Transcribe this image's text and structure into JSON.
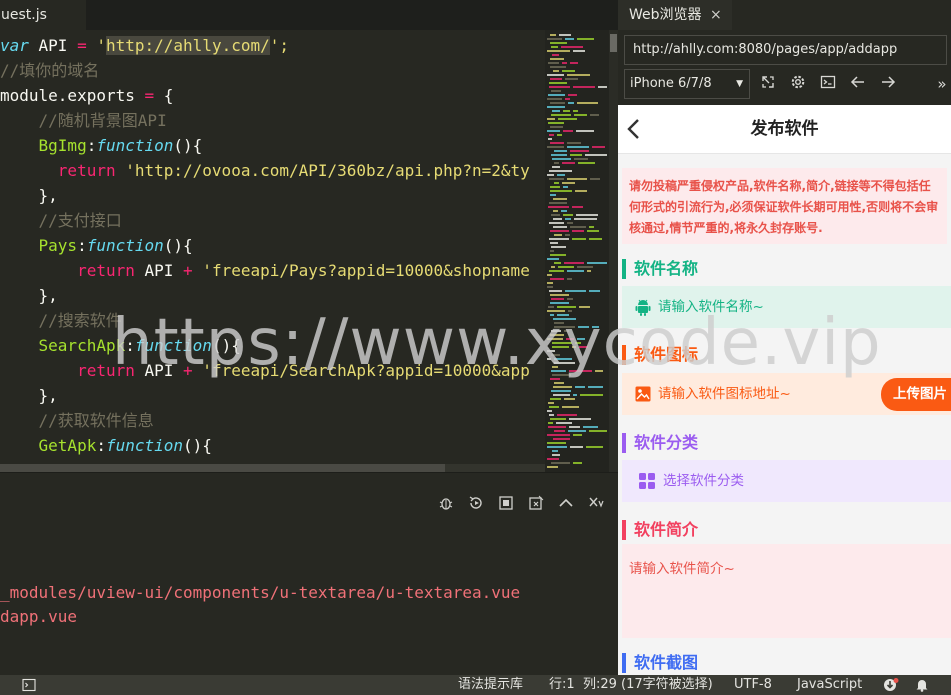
{
  "editor": {
    "tab_label": "uest.js",
    "lines": [
      {
        "segments": [
          {
            "t": "var",
            "c": "kw-i"
          },
          {
            "t": " API ",
            "c": ""
          },
          {
            "t": "=",
            "c": "op"
          },
          {
            "t": " '",
            "c": "str"
          },
          {
            "t": "http://ahlly.com/",
            "c": "str sel"
          },
          {
            "t": "';",
            "c": "str"
          }
        ]
      },
      {
        "segments": [
          {
            "t": "//填你的域名",
            "c": "cm"
          }
        ]
      },
      {
        "segments": [
          {
            "t": "module.exports ",
            "c": ""
          },
          {
            "t": "=",
            "c": "op"
          },
          {
            "t": " {",
            "c": ""
          }
        ]
      },
      {
        "segments": [
          {
            "t": "    //随机背景图API",
            "c": "cm"
          }
        ]
      },
      {
        "segments": [
          {
            "t": "    ",
            "c": ""
          },
          {
            "t": "BgImg",
            "c": "fn"
          },
          {
            "t": ":",
            "c": ""
          },
          {
            "t": "function",
            "c": "kw-i"
          },
          {
            "t": "(){",
            "c": ""
          }
        ]
      },
      {
        "segments": [
          {
            "t": "      ",
            "c": ""
          },
          {
            "t": "return",
            "c": "op"
          },
          {
            "t": " 'http://ovooa.com/API/360bz/api.php?n=2&ty",
            "c": "str"
          }
        ]
      },
      {
        "segments": [
          {
            "t": "    },",
            "c": ""
          }
        ]
      },
      {
        "segments": [
          {
            "t": "    //支付接口",
            "c": "cm"
          }
        ]
      },
      {
        "segments": [
          {
            "t": "    ",
            "c": ""
          },
          {
            "t": "Pays",
            "c": "fn"
          },
          {
            "t": ":",
            "c": ""
          },
          {
            "t": "function",
            "c": "kw-i"
          },
          {
            "t": "(){",
            "c": ""
          }
        ]
      },
      {
        "segments": [
          {
            "t": "        ",
            "c": ""
          },
          {
            "t": "return",
            "c": "op"
          },
          {
            "t": " API ",
            "c": ""
          },
          {
            "t": "+",
            "c": "op"
          },
          {
            "t": " 'freeapi/Pays?appid=10000&shopname",
            "c": "str"
          }
        ]
      },
      {
        "segments": [
          {
            "t": "    },",
            "c": ""
          }
        ]
      },
      {
        "segments": [
          {
            "t": "    //搜索软件",
            "c": "cm"
          }
        ]
      },
      {
        "segments": [
          {
            "t": "    ",
            "c": ""
          },
          {
            "t": "SearchApk",
            "c": "fn"
          },
          {
            "t": ":",
            "c": ""
          },
          {
            "t": "function",
            "c": "kw-i"
          },
          {
            "t": "(){",
            "c": ""
          }
        ]
      },
      {
        "segments": [
          {
            "t": "        ",
            "c": ""
          },
          {
            "t": "return",
            "c": "op"
          },
          {
            "t": " API ",
            "c": ""
          },
          {
            "t": "+",
            "c": "op"
          },
          {
            "t": " 'freeapi/SearchApk?appid=10000&app",
            "c": "str"
          }
        ]
      },
      {
        "segments": [
          {
            "t": "    },",
            "c": ""
          }
        ]
      },
      {
        "segments": [
          {
            "t": "    //获取软件信息",
            "c": "cm"
          }
        ]
      },
      {
        "segments": [
          {
            "t": "    ",
            "c": ""
          },
          {
            "t": "GetApk",
            "c": "fn"
          },
          {
            "t": ":",
            "c": ""
          },
          {
            "t": "function",
            "c": "kw-i"
          },
          {
            "t": "(){",
            "c": ""
          }
        ]
      }
    ]
  },
  "console": {
    "lines": [
      "_modules/uview-ui/components/u-textarea/u-textarea.vue",
      "dapp.vue"
    ],
    "tools": [
      "bug-icon",
      "restart-icon",
      "stop-icon",
      "clear-console-icon",
      "collapse-up-icon",
      "close-console-icon"
    ]
  },
  "statusbar": {
    "syntax_hint": "语法提示库",
    "line": "行:1",
    "column": "列:29 (17字符被选择)",
    "encoding": "UTF-8",
    "language": "JavaScript"
  },
  "browser": {
    "tab_label": "Web浏览器",
    "close_glyph": "×",
    "url": "http://ahlly.com:8080/pages/app/addapp",
    "device": "iPhone 6/7/8",
    "tools": [
      "screenshot-icon",
      "settings-icon",
      "terminal-icon",
      "back-arrow-icon",
      "forward-arrow-icon",
      "more-icon"
    ]
  },
  "app": {
    "title": "发布软件",
    "notice": "请勿投稿严重侵权产品,软件名称,简介,链接等不得包括任何形式的引流行为,必须保证软件长期可用性,否则将不会审核通过,情节严重的,将永久封存账号.",
    "sections": {
      "name": {
        "title": "软件名称",
        "placeholder": "请输入软件名称~"
      },
      "icon": {
        "title": "软件图标",
        "placeholder": "请输入软件图标地址~",
        "upload": "上传图片"
      },
      "category": {
        "title": "软件分类",
        "placeholder": "选择软件分类"
      },
      "intro": {
        "title": "软件简介",
        "placeholder": "请输入软件简介~"
      },
      "screenshots": {
        "title": "软件截图"
      }
    },
    "colors": {
      "name": "#13b384",
      "icon": "#fa5a13",
      "category": "#9b5cf0",
      "intro": "#f2405f",
      "screenshots": "#3f6cf2"
    }
  },
  "watermark": "https://www.xycode.vip"
}
